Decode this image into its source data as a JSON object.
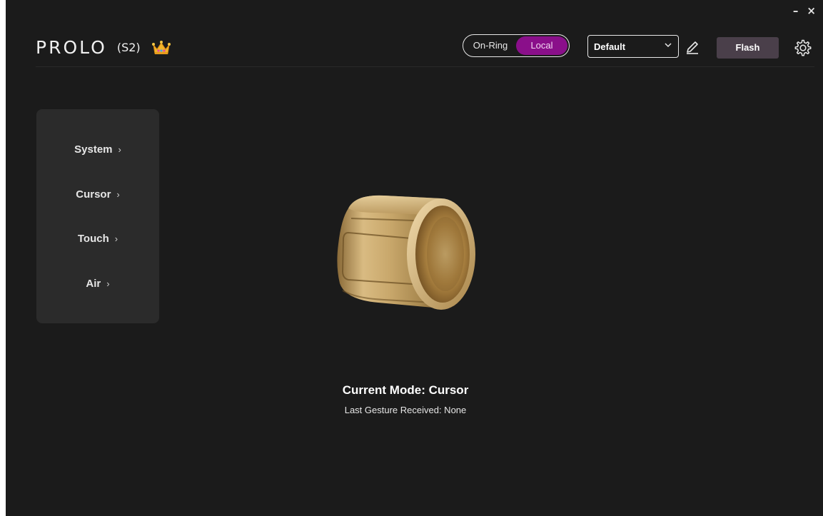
{
  "window": {
    "minimize_glyph": "–",
    "close_glyph": "×"
  },
  "header": {
    "brand": "PROLO",
    "model": "(S2)",
    "crown_icon": "crown-icon",
    "mode_toggle": {
      "options": [
        "On-Ring",
        "Local"
      ],
      "selected": "Local",
      "accent": "#8a0f8a"
    },
    "profile_select": {
      "value": "Default"
    },
    "edit_icon": "pencil-icon",
    "flash_label": "Flash",
    "settings_icon": "gear-icon"
  },
  "sidebar": {
    "items": [
      {
        "label": "System"
      },
      {
        "label": "Cursor"
      },
      {
        "label": "Touch"
      },
      {
        "label": "Air"
      }
    ],
    "chevron_glyph": "›"
  },
  "main": {
    "device_image": "gold-ring",
    "current_mode": "Current Mode: Cursor",
    "last_gesture": "Last Gesture Received: None"
  }
}
